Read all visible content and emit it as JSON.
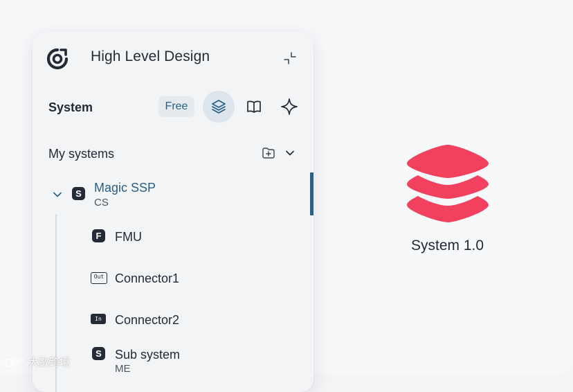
{
  "header": {
    "title": "High Level Design"
  },
  "toolbar": {
    "section_label": "System",
    "plan_badge": "Free"
  },
  "systems": {
    "heading": "My systems",
    "root": {
      "badge": "S",
      "name": "Magic SSP",
      "subtitle": "CS"
    },
    "children": [
      {
        "badge": "F",
        "name": "FMU",
        "subtitle": ""
      },
      {
        "badge": "Out",
        "name": "Connector1",
        "subtitle": ""
      },
      {
        "badge": "In",
        "name": "Connector2",
        "subtitle": ""
      },
      {
        "badge": "S",
        "name": "Sub system",
        "subtitle": "ME"
      }
    ]
  },
  "preview": {
    "label": "System 1.0"
  },
  "watermark": {
    "text": "大數跨境"
  },
  "colors": {
    "accent": "#2a5f86",
    "brand_red": "#f1415f",
    "dark": "#232b36"
  },
  "icons": {
    "app_logo": "app-logo-icon",
    "collapse": "collapse-icon",
    "layers": "layers-icon",
    "book": "book-icon",
    "sparkle": "sparkle-icon",
    "new_folder": "folder-plus-icon",
    "chevron": "chevron-down-icon"
  }
}
